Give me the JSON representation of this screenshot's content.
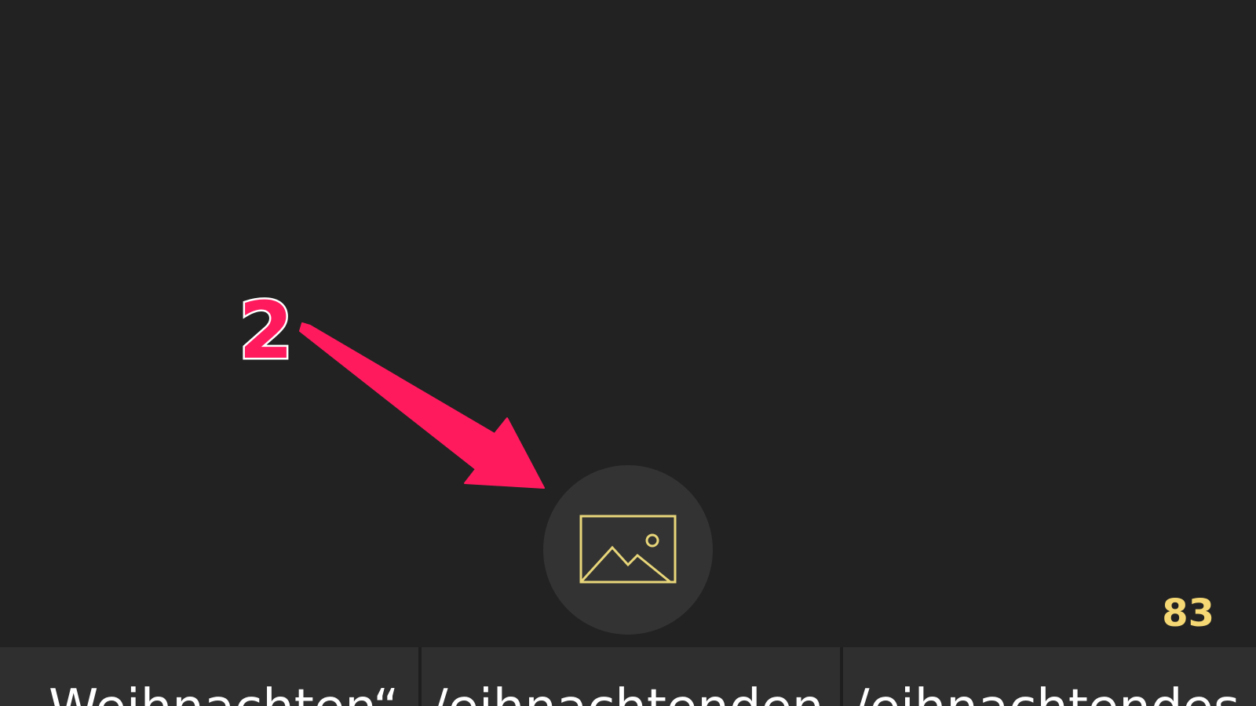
{
  "annotation": {
    "step_number": "2",
    "color": "#ff1a5e"
  },
  "image_button": {
    "icon": "image-icon",
    "icon_color": "#e8d67a"
  },
  "counter": {
    "value": "83",
    "color": "#f5d874"
  },
  "suggestions": [
    {
      "text": "Weihnachten“"
    },
    {
      "text": "/eihnachtenden"
    },
    {
      "text": "/eihnachtendes"
    }
  ]
}
